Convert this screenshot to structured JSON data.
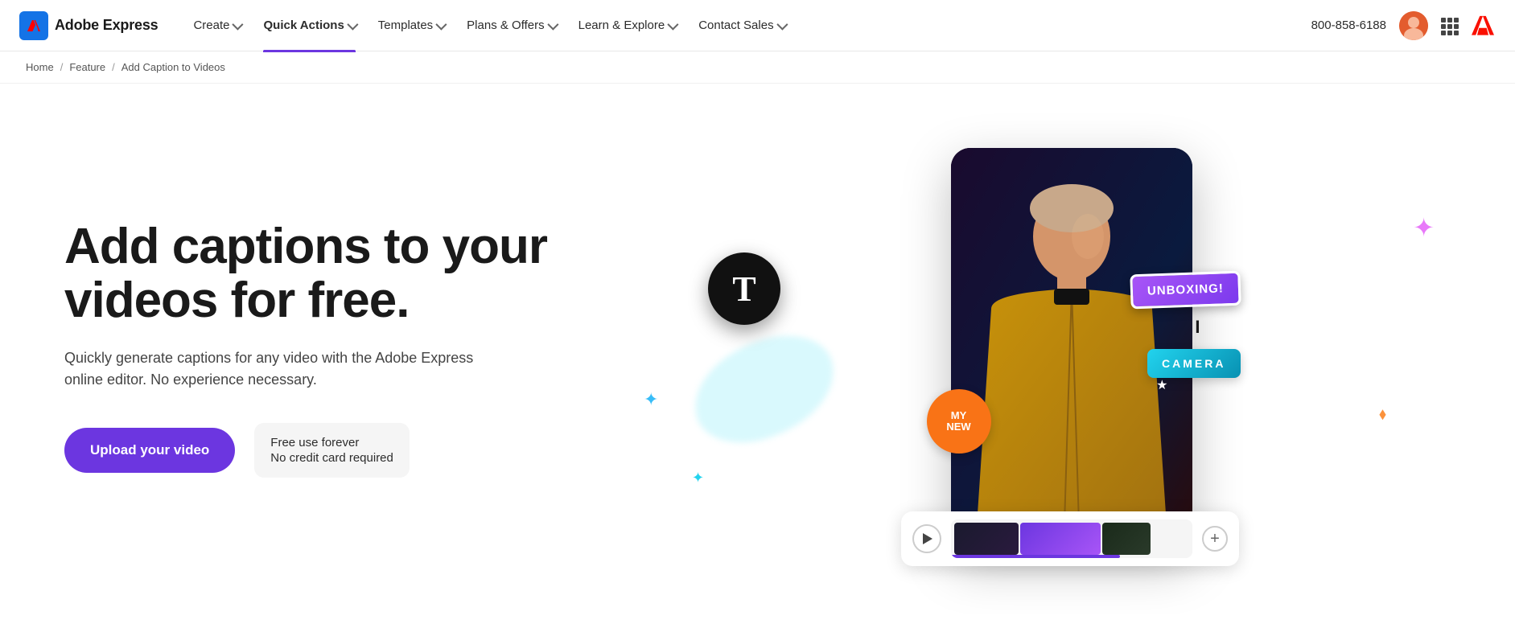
{
  "nav": {
    "logo_text": "Adobe Express",
    "items": [
      {
        "id": "create",
        "label": "Create",
        "has_dropdown": true,
        "active": false
      },
      {
        "id": "quick-actions",
        "label": "Quick Actions",
        "has_dropdown": true,
        "active": true
      },
      {
        "id": "templates",
        "label": "Templates",
        "has_dropdown": true,
        "active": false
      },
      {
        "id": "plans-offers",
        "label": "Plans & Offers",
        "has_dropdown": true,
        "active": false
      },
      {
        "id": "learn-explore",
        "label": "Learn & Explore",
        "has_dropdown": true,
        "active": false
      },
      {
        "id": "contact-sales",
        "label": "Contact Sales",
        "has_dropdown": true,
        "active": false
      }
    ],
    "phone": "800-858-6188"
  },
  "breadcrumb": {
    "items": [
      {
        "label": "Home",
        "href": "#"
      },
      {
        "label": "Feature",
        "href": "#"
      },
      {
        "label": "Add Caption to Videos",
        "href": null
      }
    ]
  },
  "hero": {
    "title": "Add captions to your videos for free.",
    "subtitle": "Quickly generate captions for any video with the Adobe Express online editor. No experience necessary.",
    "cta_label": "Upload your video",
    "free_line1": "Free use forever",
    "free_line2": "No credit card required",
    "sticker_unboxing": "UNBOXING!",
    "sticker_camera": "CAMERA",
    "sticker_mynew": "MY NEW",
    "t_letter": "T"
  }
}
